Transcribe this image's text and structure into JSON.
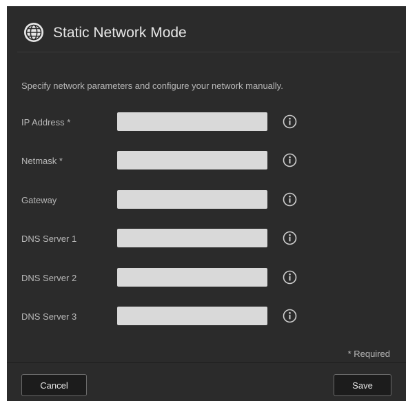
{
  "dialog": {
    "title": "Static Network Mode",
    "title_icon": "globe-icon",
    "description": "Specify network parameters and configure your network manually.",
    "fields": [
      {
        "label": "IP Address *",
        "value": "",
        "info_icon": "info-icon"
      },
      {
        "label": "Netmask *",
        "value": "",
        "info_icon": "info-icon"
      },
      {
        "label": "Gateway",
        "value": "",
        "info_icon": "info-icon"
      },
      {
        "label": "DNS Server 1",
        "value": "",
        "info_icon": "info-icon"
      },
      {
        "label": "DNS Server 2",
        "value": "",
        "info_icon": "info-icon"
      },
      {
        "label": "DNS Server 3",
        "value": "",
        "info_icon": "info-icon"
      }
    ],
    "required_note": "* Required",
    "buttons": {
      "cancel_label": "Cancel",
      "save_label": "Save"
    }
  },
  "colors": {
    "dialog_bg": "#2b2b2b",
    "input_bg": "#d9d9d9",
    "text": "#b7b7b7",
    "title_text": "#e6e6e6"
  }
}
